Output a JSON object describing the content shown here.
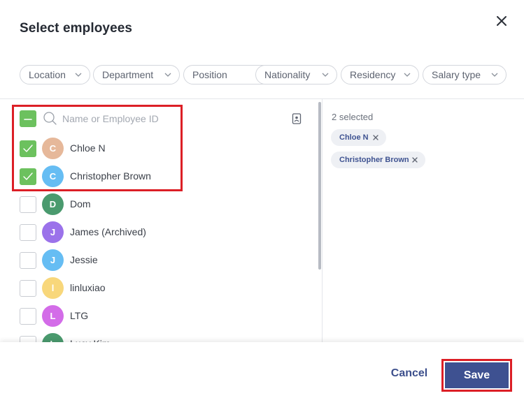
{
  "dialog": {
    "title": "Select employees"
  },
  "filters": [
    {
      "label": "Location"
    },
    {
      "label": "Department"
    },
    {
      "label": "Position"
    },
    {
      "label": "Nationality"
    },
    {
      "label": "Residency"
    },
    {
      "label": "Salary type"
    }
  ],
  "search": {
    "placeholder": "Name or Employee ID",
    "value": ""
  },
  "employees": [
    {
      "name": "Chloe N",
      "initial": "C",
      "checked": true,
      "color": "#e6b89a"
    },
    {
      "name": "Christopher Brown",
      "initial": "C",
      "checked": true,
      "color": "#66bdf3"
    },
    {
      "name": "Dom",
      "initial": "D",
      "checked": false,
      "color": "#4a9a6e"
    },
    {
      "name": "James (Archived)",
      "initial": "J",
      "checked": false,
      "color": "#9b72ea"
    },
    {
      "name": "Jessie",
      "initial": "J",
      "checked": false,
      "color": "#66bdf3"
    },
    {
      "name": "linluxiao",
      "initial": "l",
      "checked": false,
      "color": "#f8d77b"
    },
    {
      "name": "LTG",
      "initial": "L",
      "checked": false,
      "color": "#d36ce8"
    },
    {
      "name": "Lucy Kim",
      "initial": "L",
      "checked": false,
      "color": "#4a9a6e"
    }
  ],
  "selection": {
    "count_label": "2 selected",
    "chips": [
      {
        "label": "Chloe N"
      },
      {
        "label": "Christopher Brown"
      }
    ]
  },
  "footer": {
    "cancel_label": "Cancel",
    "save_label": "Save"
  },
  "colors": {
    "accent": "#3e5191",
    "check_green": "#6cc15e",
    "highlight_red": "#dc1f26"
  }
}
